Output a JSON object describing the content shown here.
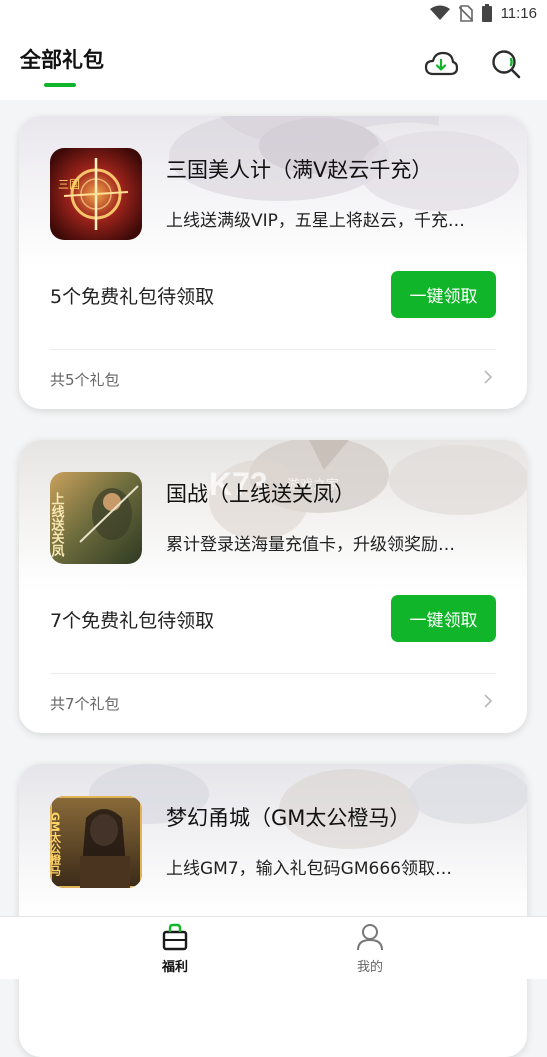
{
  "status_bar": {
    "time": "11:16",
    "icons": [
      "wifi-icon",
      "no-sim-icon",
      "battery-icon"
    ]
  },
  "header": {
    "title": "全部礼包",
    "actions": [
      "cloud-download-icon",
      "search-icon"
    ]
  },
  "watermark": {
    "brand": "K73",
    "subtitle": "游戏之家"
  },
  "cards": [
    {
      "name": "三国美人计（满V赵云千充）",
      "desc": "上线送满级VIP，五星上将赵云，千充…",
      "free_label": "5个免费礼包待领取",
      "button_label": "一键领取",
      "total_label": "共5个礼包",
      "icon_text": "三国"
    },
    {
      "name": "国战（上线送关凤）",
      "desc": "累计登录送海量充值卡，升级领奖励…",
      "free_label": "7个免费礼包待领取",
      "button_label": "一键领取",
      "total_label": "共7个礼包",
      "icon_text": "上线送关凤"
    },
    {
      "name": "梦幻甬城（GM太公橙马）",
      "desc": "上线GM7，输入礼包码GM666领取…",
      "icon_text": "GM太公橙马"
    }
  ],
  "bottom_nav": {
    "tabs": [
      {
        "label": "福利",
        "icon": "gift-bag-icon",
        "active": true
      },
      {
        "label": "我的",
        "icon": "user-icon",
        "active": false
      }
    ]
  },
  "colors": {
    "accent": "#11b52a",
    "background": "#f4f5f6",
    "text": "#222222"
  }
}
